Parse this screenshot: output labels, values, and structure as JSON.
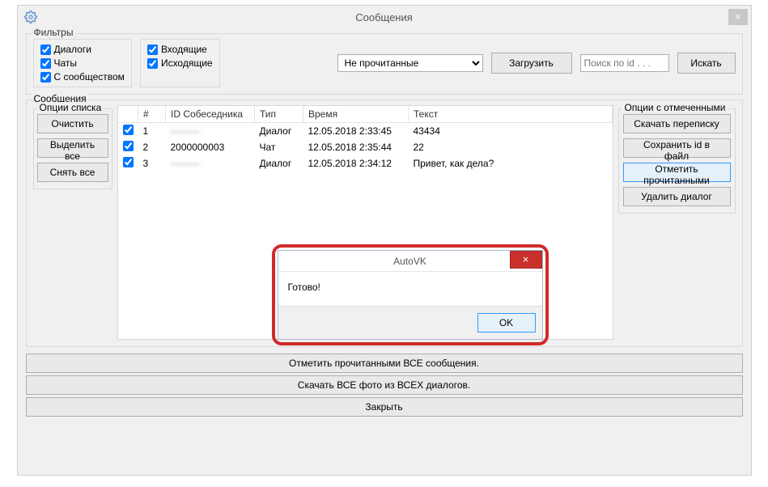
{
  "window": {
    "title": "Сообщения",
    "close_label": "×"
  },
  "filters": {
    "legend": "Фильтры",
    "group1": {
      "dialogs": "Диалоги",
      "chats": "Чаты",
      "community": "С сообществом"
    },
    "group2": {
      "incoming": "Входящие",
      "outgoing": "Исходящие"
    },
    "status_select": {
      "selected": "Не прочитанные"
    },
    "load_button": "Загрузить",
    "search_placeholder": "Поиск по id . . .",
    "search_button": "Искать"
  },
  "messages": {
    "legend": "Сообщения",
    "list_opts": {
      "legend": "Опции списка",
      "clear": "Очистить",
      "select_all": "Выделить все",
      "deselect_all": "Снять все"
    },
    "columns": {
      "num": "#",
      "id": "ID Собеседника",
      "type": "Тип",
      "time": "Время",
      "text": "Текст"
    },
    "rows": [
      {
        "checked": true,
        "num": "1",
        "id_blurred": true,
        "id": "———",
        "type": "Диалог",
        "time": "12.05.2018 2:33:45",
        "text": "43434"
      },
      {
        "checked": true,
        "num": "2",
        "id_blurred": false,
        "id": "2000000003",
        "type": "Чат",
        "time": "12.05.2018 2:35:44",
        "text": "22"
      },
      {
        "checked": true,
        "num": "3",
        "id_blurred": true,
        "id": "———",
        "type": "Диалог",
        "time": "12.05.2018 2:34:12",
        "text": "Привет, как дела?"
      }
    ],
    "sel_opts": {
      "legend": "Опции с отмеченными",
      "download_chat": "Скачать переписку",
      "save_id": "Сохранить id в файл",
      "mark_read": "Отметить прочитанными",
      "delete_dialog": "Удалить диалог"
    }
  },
  "bottom": {
    "mark_all_read": "Отметить прочитанными ВСЕ сообщения.",
    "download_all_photos": "Скачать ВСЕ фото из ВСЕХ диалогов.",
    "close": "Закрыть"
  },
  "modal": {
    "title": "AutoVK",
    "body": "Готово!",
    "ok": "OK",
    "close": "×"
  }
}
